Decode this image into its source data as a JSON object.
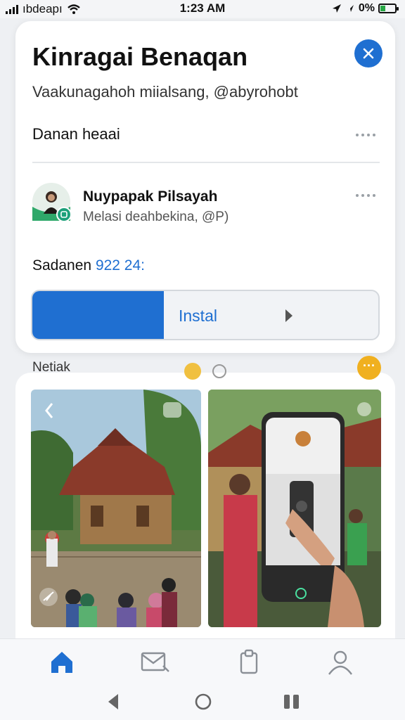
{
  "status_bar": {
    "carrier": "ıbdeapı",
    "time": "1:23 AM",
    "battery": "0%",
    "battery_level": 0.35
  },
  "sheet": {
    "title": "Kinragai Benaqan",
    "subtitle": "Vaakunagahoh miialsang, @abyrohobt",
    "section_label": "Danan heaai",
    "close_icon": "close-icon"
  },
  "profile": {
    "name": "Nuypapak Pilsayah",
    "sub": "Melasi deahbekina, @P)"
  },
  "price": {
    "prefix": "Sadanen",
    "amount": "922 24:"
  },
  "install": {
    "label": "Instal",
    "progress": 0.38
  },
  "peek": {
    "label": "Netiak"
  },
  "colors": {
    "accent": "#1f6fd1",
    "sheet_bg": "#ffffff",
    "page_bg": "#eef0f3"
  },
  "tabbar": {
    "items": [
      "home-icon",
      "mail-icon",
      "clipboard-icon",
      "profile-icon"
    ],
    "active": "home-icon"
  },
  "system_nav": [
    "back-icon",
    "home-circle-icon",
    "recents-icon"
  ]
}
